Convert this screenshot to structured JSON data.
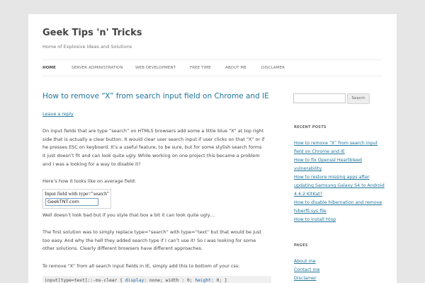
{
  "site": {
    "title": "Geek Tips 'n' Tricks",
    "tagline": "Home of Explosive Ideas and Solutions"
  },
  "nav": {
    "items": [
      "HOME",
      "SERVER ADMINISTRATION",
      "WEB DEVELOPMENT",
      "FREE TIME",
      "ABOUT ME",
      "DISCLAMER"
    ]
  },
  "post": {
    "title": "How to remove “X” from search input field on Chrome and IE",
    "leave_reply": "Leave a reply",
    "p1": [
      "On input fields that are type “search” on HTML5 browsers add some a little blue “X” at top right",
      "side that is actually a clear button. It would clear user search input if user clicks on that “X” or if",
      "he presses ESC on keyboard. It’s a useful feature, to be sure, but for some stylish search forms",
      "it just doesn’t fit and can look quite ugly. While working on one project this became a problem",
      "and I was a looking for a way to disable it?"
    ],
    "p2": [
      "Here’s how it looks like on average field:"
    ],
    "demo": {
      "label": "Input field with type=\"search\"",
      "value": "GeekTNT.com"
    },
    "p3": [
      "Well doesn’t look bad but if you style that box a bit it can look quite ugly…"
    ],
    "p4": [
      "The first solution was to simply replace type=“search” with type=“text” but that would be just",
      "too easy. And why the hell they added search type if I can’t use it! So I was looking for some",
      "other solutions. Clearly different browsers have different approaches."
    ],
    "p5": [
      "To remove “X” from all search input fields in IE, simply add this to bottom of your css:"
    ],
    "code": {
      "selector": "input[type=text]::-ms-clear {  ",
      "prop1": "display",
      "val1": ": none; width : 0; ",
      "prop2": "height",
      "val2": ": 0; }"
    }
  },
  "sidebar": {
    "search_button": "Search",
    "recent_posts_title": "RECENT POSTS",
    "recent_posts": [
      [
        "How to remove “X” from search input",
        "field on Chrome and IE"
      ],
      [
        "How to fix Openssl Heartbleed",
        "vulnerability"
      ],
      [
        "How to restore missing apps after",
        "updating Samsung Galaxy S4 to Android",
        "4.4.2 KitKat?"
      ],
      [
        "How to disable hibernation and remove",
        "hiberfil.sys file"
      ],
      [
        "How to install htop"
      ]
    ],
    "pages_title": "PAGES",
    "pages": [
      "About me",
      "Contact me",
      "Disclamer"
    ]
  }
}
